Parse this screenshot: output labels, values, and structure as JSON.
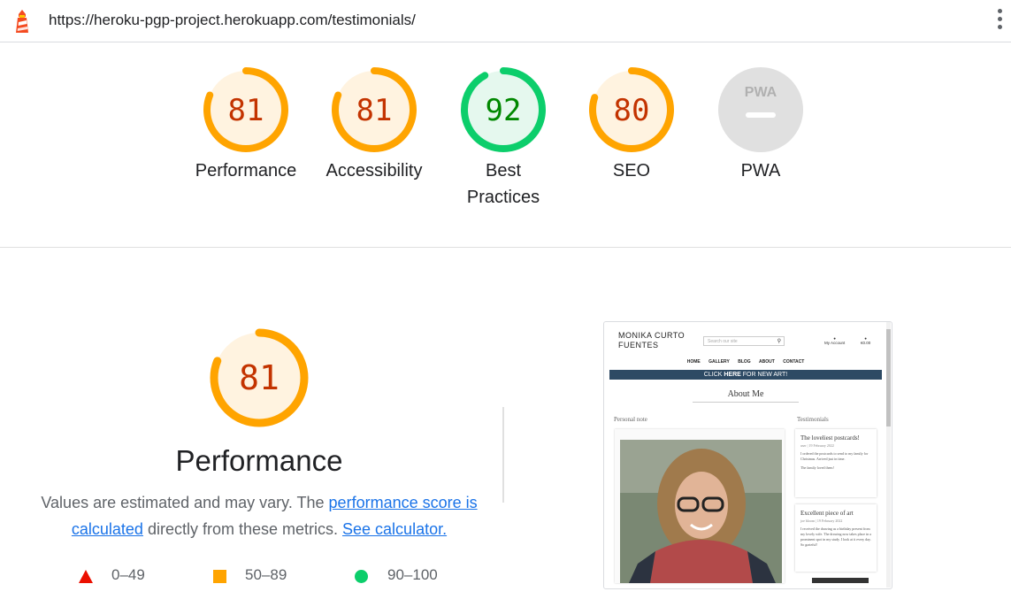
{
  "browser": {
    "url": "https://heroku-pgp-project.herokuapp.com/testimonials/",
    "logo_icon": "lighthouse-icon",
    "menu_icon": "more-vert-icon"
  },
  "colors": {
    "average": "#ffa400",
    "average_text": "#c33300",
    "average_fill": "#fff3e0",
    "pass": "#0cce6b",
    "pass_text": "#008800",
    "pass_fill": "#e5f8ee",
    "fail": "#eb0f00",
    "na": "#e0e0e0",
    "link": "#1a73e8"
  },
  "gauges": [
    {
      "id": "performance",
      "score": "81",
      "label": "Performance",
      "status": "average",
      "fraction": 0.81
    },
    {
      "id": "accessibility",
      "score": "81",
      "label": "Accessibility",
      "status": "average",
      "fraction": 0.81
    },
    {
      "id": "best-practices",
      "score": "92",
      "label_line1": "Best",
      "label_line2": "Practices",
      "status": "pass",
      "fraction": 0.92
    },
    {
      "id": "seo",
      "score": "80",
      "label": "SEO",
      "status": "average",
      "fraction": 0.8
    },
    {
      "id": "pwa",
      "label": "PWA",
      "badge_text": "PWA",
      "status": "na"
    }
  ],
  "performance": {
    "score": "81",
    "fraction": 0.81,
    "title": "Performance",
    "desc_prefix": "Values are estimated and may vary. The ",
    "link1": "performance score is calculated",
    "desc_mid": " directly from these metrics. ",
    "link2": "See calculator.",
    "legend": [
      {
        "range": "0–49",
        "shape": "triangle"
      },
      {
        "range": "50–89",
        "shape": "square"
      },
      {
        "range": "90–100",
        "shape": "circle"
      }
    ]
  },
  "screenshot": {
    "brand_line1": "MONIKA CURTO",
    "brand_line2": "FUENTES",
    "search_placeholder": "Search our site",
    "account_label": "My Account",
    "cart_label": "€0.00",
    "nav": [
      "HOME",
      "GALLERY",
      "BLOG",
      "ABOUT",
      "CONTACT"
    ],
    "banner_pre": "CLICK ",
    "banner_bold": "HERE",
    "banner_post": " FOR NEW ART!",
    "heading": "About Me",
    "left_label": "Personal note",
    "right_label": "Testimonials",
    "card1": {
      "title": "The loveliest postcards!",
      "meta": "user | 19 February 2022",
      "body": "I ordered the postcards to send to my family for Christmas. Arrived just in time.",
      "body2": "The family loved them!"
    },
    "card2": {
      "title": "Excellent piece of art",
      "meta": "joe bloom | 19 February 2022",
      "body": "I received the drawing as a birthday present from my lovely wife. The drawing now takes place in a prominent spot in my study. I look at it every day. So grateful!"
    }
  }
}
